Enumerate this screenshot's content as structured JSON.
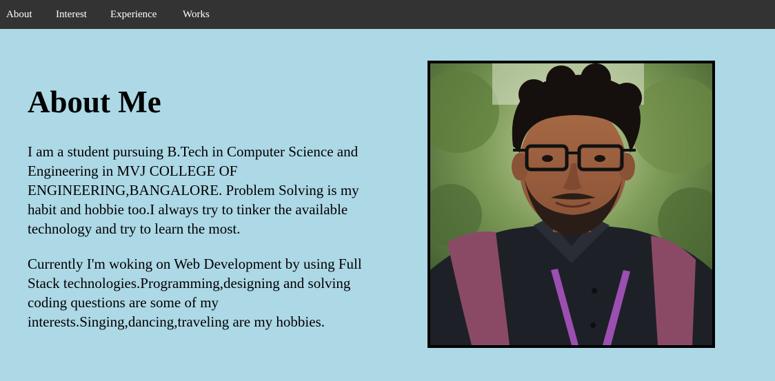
{
  "nav": {
    "items": [
      {
        "label": "About"
      },
      {
        "label": "Interest"
      },
      {
        "label": "Experience"
      },
      {
        "label": "Works"
      }
    ]
  },
  "about": {
    "title": "About Me",
    "paragraph_1": "I am a student pursuing B.Tech in Computer Science and Engineering in MVJ COLLEGE OF ENGINEERING,BANGALORE. Problem Solving is my habit and hobbie too.I always try to tinker the available technology and try to learn the most.",
    "paragraph_2": "Currently I'm woking on Web Development by using Full Stack technologies.Programming,designing and solving coding questions are some of my interests.Singing,dancing,traveling are my hobbies."
  },
  "colors": {
    "background": "#add8e6",
    "navbar": "#333333",
    "nav_text": "#ffffff",
    "text": "#000000",
    "frame_border": "#000000"
  }
}
